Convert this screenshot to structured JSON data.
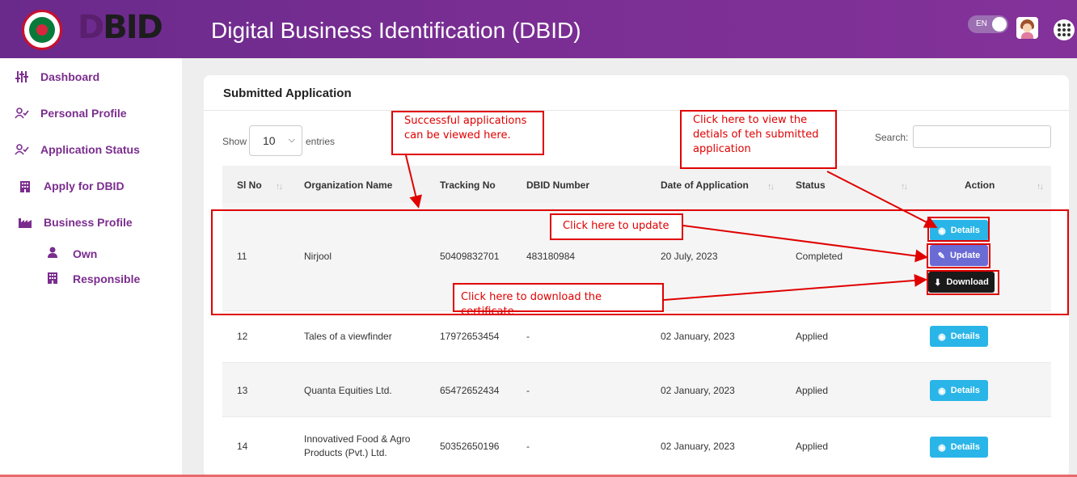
{
  "header": {
    "logo_text_first": "D",
    "logo_text_rest": "BID",
    "title": "Digital Business Identification (DBID)",
    "lang": "EN"
  },
  "sidebar": {
    "items": [
      {
        "label": "Dashboard",
        "icon": "sliders-icon"
      },
      {
        "label": "Personal Profile",
        "icon": "user-check-icon"
      },
      {
        "label": "Application Status",
        "icon": "user-check-icon"
      },
      {
        "label": "Apply for DBID",
        "icon": "building-icon"
      },
      {
        "label": "Business Profile",
        "icon": "industry-icon"
      }
    ],
    "sub_items": [
      {
        "label": "Own",
        "icon": "user-icon"
      },
      {
        "label": "Responsible",
        "icon": "building-icon"
      }
    ]
  },
  "card": {
    "title": "Submitted Application",
    "show_label": "Show",
    "entries_value": "10",
    "entries_label": "entries",
    "search_label": "Search:"
  },
  "table": {
    "columns": [
      "Sl No",
      "Organization Name",
      "Tracking No",
      "DBID Number",
      "Date of Application",
      "Status",
      "Action"
    ],
    "rows": [
      {
        "sl": "11",
        "org": "Nirjool",
        "tracking": "50409832701",
        "dbid": "483180984",
        "date": "20 July, 2023",
        "status": "Completed"
      },
      {
        "sl": "12",
        "org": "Tales of a viewfinder",
        "tracking": "17972653454",
        "dbid": "-",
        "date": "02 January, 2023",
        "status": "Applied"
      },
      {
        "sl": "13",
        "org": "Quanta Equities Ltd.",
        "tracking": "65472652434",
        "dbid": "-",
        "date": "02 January, 2023",
        "status": "Applied"
      },
      {
        "sl": "14",
        "org_line1": "Innovatived Food & Agro",
        "org_line2": "Products (Pvt.) Ltd.",
        "tracking": "50352650196",
        "dbid": "-",
        "date": "02 January, 2023",
        "status": "Applied"
      }
    ],
    "buttons": {
      "details": "Details",
      "update": "Update",
      "download": "Download"
    }
  },
  "annotations": {
    "successful_line1": "Successful applications",
    "successful_line2": "can be viewed here.",
    "details_line1": "Click here to view the",
    "details_line2": "detials of teh submitted",
    "details_line3": "application",
    "update": "Click here to update",
    "download": "Click here to download the certificate"
  },
  "colors": {
    "header": "#7a2e93",
    "accent": "#7b2d8e",
    "details_button": "#2ab5e8",
    "update_button": "#6b6bd6",
    "download_button": "#1a1a1a",
    "annotation": "#e00000"
  }
}
